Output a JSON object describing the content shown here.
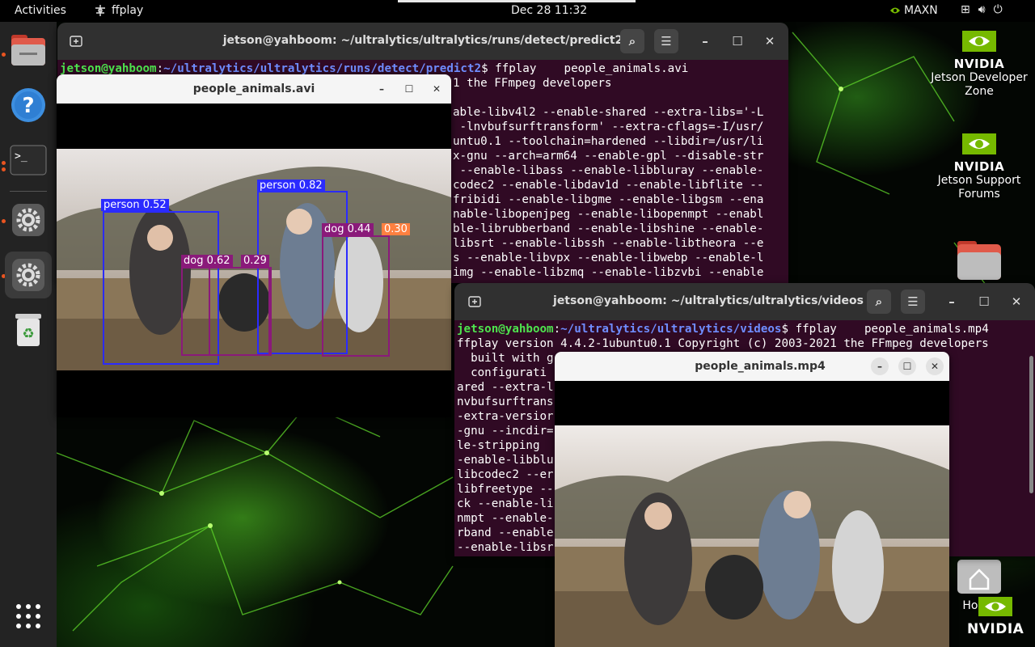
{
  "topbar": {
    "activities": "Activities",
    "app_name": "ffplay",
    "clock": "Dec 28  11:32",
    "power_mode": "MAXN"
  },
  "dock": {
    "items": [
      {
        "name": "files",
        "icon": "folder-icon"
      },
      {
        "name": "help",
        "icon": "help-icon"
      },
      {
        "name": "terminal",
        "icon": "terminal-icon"
      },
      {
        "name": "settings",
        "icon": "gear-icon"
      },
      {
        "name": "settings-2",
        "icon": "gear-icon"
      },
      {
        "name": "trash",
        "icon": "trash-icon"
      },
      {
        "name": "show-apps",
        "icon": "app-grid-icon"
      }
    ]
  },
  "desktop": {
    "icons": [
      {
        "logo": "NVIDIA",
        "label": "Jetson Developer Zone"
      },
      {
        "logo": "NVIDIA",
        "label": "Jetson Support Forums"
      },
      {
        "label": "Home"
      }
    ],
    "watermark": "NVIDIA"
  },
  "terminal1": {
    "title": "jetson@yahboom: ~/ultralytics/ultralytics/runs/detect/predict2",
    "prompt_user": "jetson@yahboom",
    "prompt_path": "~/ultralytics/ultralytics/runs/detect/predict2",
    "command": "$ ffplay    people_animals.avi",
    "lines": [
      "1 the FFmpeg developers",
      "",
      "able-libv4l2 --enable-shared --extra-libs='-L",
      " -lnvbufsurftransform' --extra-cflags=-I/usr/",
      "untu0.1 --toolchain=hardened --libdir=/usr/li",
      "x-gnu --arch=arm64 --enable-gpl --disable-str",
      " --enable-libass --enable-libbluray --enable-",
      "codec2 --enable-libdav1d --enable-libflite --",
      "fribidi --enable-libgme --enable-libgsm --ena",
      "nable-libopenjpeg --enable-libopenmpt --enabl",
      "ble-librubberband --enable-libshine --enable-",
      "libsrt --enable-libssh --enable-libtheora --e",
      "s --enable-libvpx --enable-libwebp --enable-l",
      "img --enable-libzmq --enable-libzvbi --enable"
    ]
  },
  "terminal2": {
    "title": "jetson@yahboom: ~/ultralytics/ultralytics/videos",
    "prompt_user": "jetson@yahboom",
    "prompt_path": "~/ultralytics/ultralytics/videos",
    "command": "$ ffplay    people_animals.mp4",
    "lines": [
      "ffplay version 4.4.2-1ubuntu0.1 Copyright (c) 2003-2021 the FFmpeg developers",
      "  built with g",
      "  configurati                                              -enable-sh",
      "ared --extra-l                                            surface -l",
      "nvbufsurftrans                                           /include/ -",
      "-extra-versior                                          arch64-linux",
      "-gnu --incdir=                                           pl --disab",
      "le-stripping                                           e-libass -",
      "-enable-libblu                                           --enable-",
      "libcodec2 --er                                           --enable-",
      "libfreetype --                                          able-libja",
      "ck --enable-li                                          able-libope",
      "nmpt --enable-                                          e-librubbe",
      "rband --enable                                          -libspeex",
      "--enable-libsr                                          me --enabl"
    ]
  },
  "video_avi": {
    "title": "people_animals.avi",
    "detections": [
      {
        "label": "person 0.52",
        "color": "#2b2bff"
      },
      {
        "label": "person 0.82",
        "color": "#2b2bff"
      },
      {
        "label": "dog 0.62",
        "color": "#8a1a7a"
      },
      {
        "label": "0.29",
        "color": "#8a1a7a"
      },
      {
        "label": "dog 0.44",
        "color": "#8a1a7a"
      },
      {
        "label": "0.30",
        "color": "#ff8040"
      }
    ]
  },
  "video_mp4": {
    "title": "people_animals.mp4"
  },
  "colors": {
    "terminal_bg": "#300a24",
    "prompt_user": "#4ee34e",
    "prompt_path": "#6f8dff",
    "accent": "#e95420",
    "nvidia_green": "#76b900"
  }
}
